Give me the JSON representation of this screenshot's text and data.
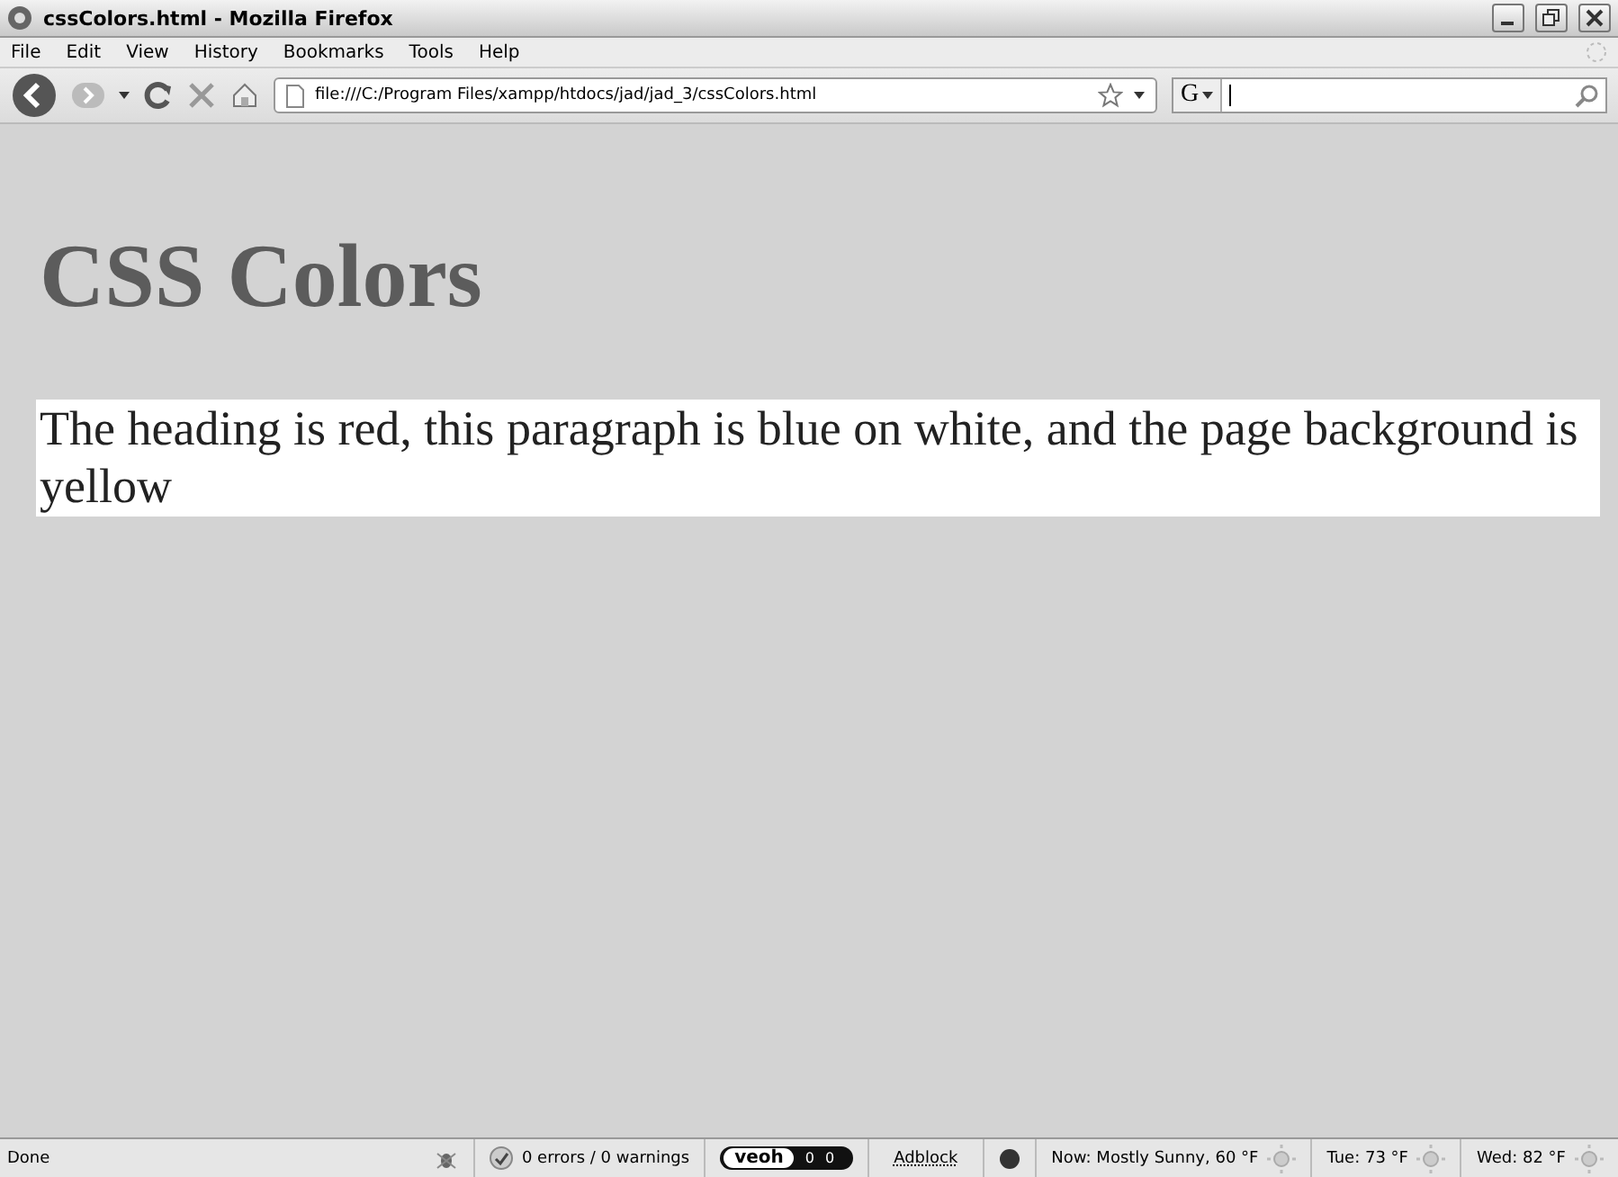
{
  "window": {
    "title": "cssColors.html - Mozilla Firefox"
  },
  "menu": [
    "File",
    "Edit",
    "View",
    "History",
    "Bookmarks",
    "Tools",
    "Help"
  ],
  "toolbar": {
    "url": "file:///C:/Program Files/xampp/htdocs/jad/jad_3/cssColors.html",
    "search_engine": "G"
  },
  "page": {
    "heading": "CSS Colors",
    "paragraph": "The heading is red, this paragraph is blue on white, and the page background is yellow"
  },
  "status_bar": {
    "status": "Done",
    "validator": "0 errors / 0 warnings",
    "veoh": {
      "logo": "veoh",
      "counts": [
        "0",
        "0"
      ]
    },
    "adblock": "Adblock",
    "weather": [
      "Now: Mostly Sunny, 60 °F",
      "Tue: 73 °F",
      "Wed: 82 °F"
    ]
  }
}
